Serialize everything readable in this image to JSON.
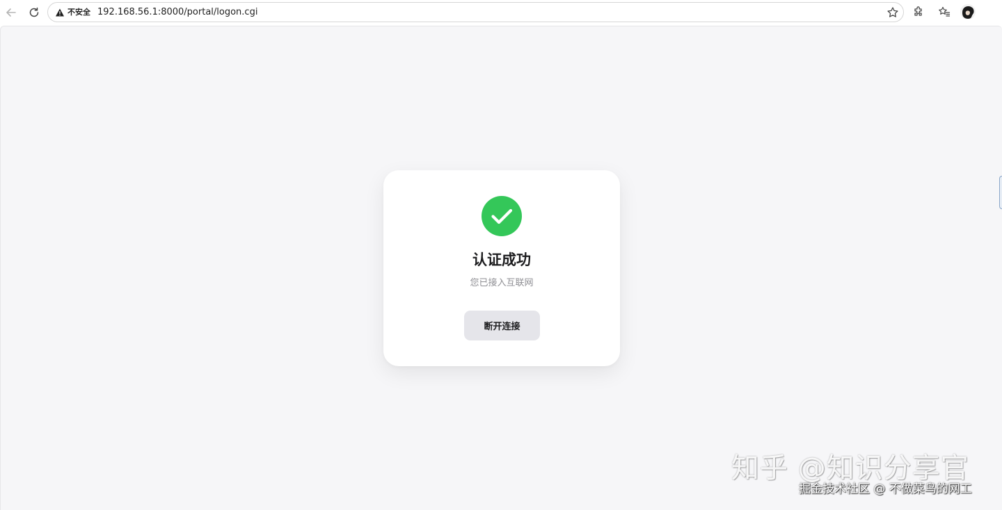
{
  "browser": {
    "security_label": "不安全",
    "url": "192.168.56.1:8000/portal/logon.cgi",
    "icons": {
      "back": "arrow-left-icon",
      "reload": "reload-icon",
      "security": "warning-triangle-icon",
      "bookmark": "star-icon",
      "extensions": "puzzle-icon",
      "favorites": "favorites-icon",
      "profile": "avatar"
    }
  },
  "card": {
    "status_icon": "check-circle-icon",
    "status_color": "#34c759",
    "title": "认证成功",
    "subtitle": "您已接入互联网",
    "disconnect_label": "断开连接"
  },
  "watermark": {
    "main": "知乎 @知识分享官",
    "sub": "掘金技术社区 @ 不做菜鸟的网工"
  }
}
